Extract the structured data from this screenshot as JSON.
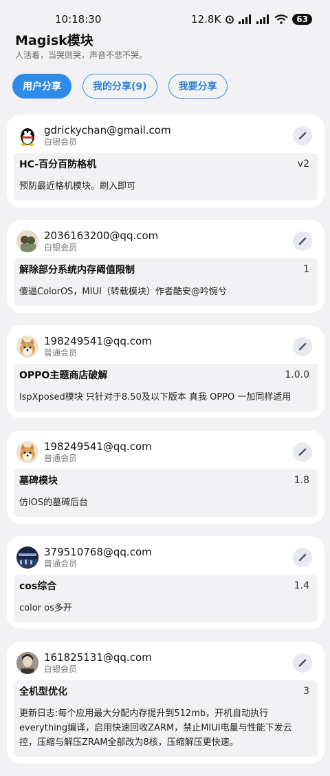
{
  "status": {
    "time": "10:18:30",
    "net_speed": "12.8K",
    "battery": "63"
  },
  "header": {
    "title": "Magisk模块",
    "subtitle": "人活着，当哭则哭，声音不悲不哭。"
  },
  "tabs": [
    {
      "label": "用户分享"
    },
    {
      "label": "我的分享(9)"
    },
    {
      "label": "我要分享"
    }
  ],
  "cards": [
    {
      "email": "gdrickychan@gmail.com",
      "level": "白银会员",
      "module": "HC-百分百防格机",
      "version": "v2",
      "desc": "预防最近格机模块。刷入即可"
    },
    {
      "email": "2036163200@qq.com",
      "level": "白银会员",
      "module": "解除部分系统内存阈值限制",
      "version": "1",
      "desc": "傻逼ColorOS，MIUI（转载模块）作者酷安@吟惋兮"
    },
    {
      "email": "198249541@qq.com",
      "level": "普通会员",
      "module": "OPPO主题商店破解",
      "version": "1.0.0",
      "desc": "lspXposed模块 只针对于8.50及以下版本 真我 OPPO 一加同样适用"
    },
    {
      "email": "198249541@qq.com",
      "level": "普通会员",
      "module": "墓碑模块",
      "version": "1.8",
      "desc": "仿iOS的墓碑后台"
    },
    {
      "email": "379510768@qq.com",
      "level": "普通会员",
      "module": "cos综合",
      "version": "1.4",
      "desc": "color os多开"
    },
    {
      "email": "161825131@qq.com",
      "level": "白银会员",
      "module": "全机型优化",
      "version": "3",
      "desc": "更新日志:每个应用最大分配内存提升到512mb，开机自动执行everything编译，启用快速回收ZARM，禁止MIUI电量与性能下发云控，压缩与解压ZRAM全部改为8核，压缩解压更快速。"
    }
  ]
}
